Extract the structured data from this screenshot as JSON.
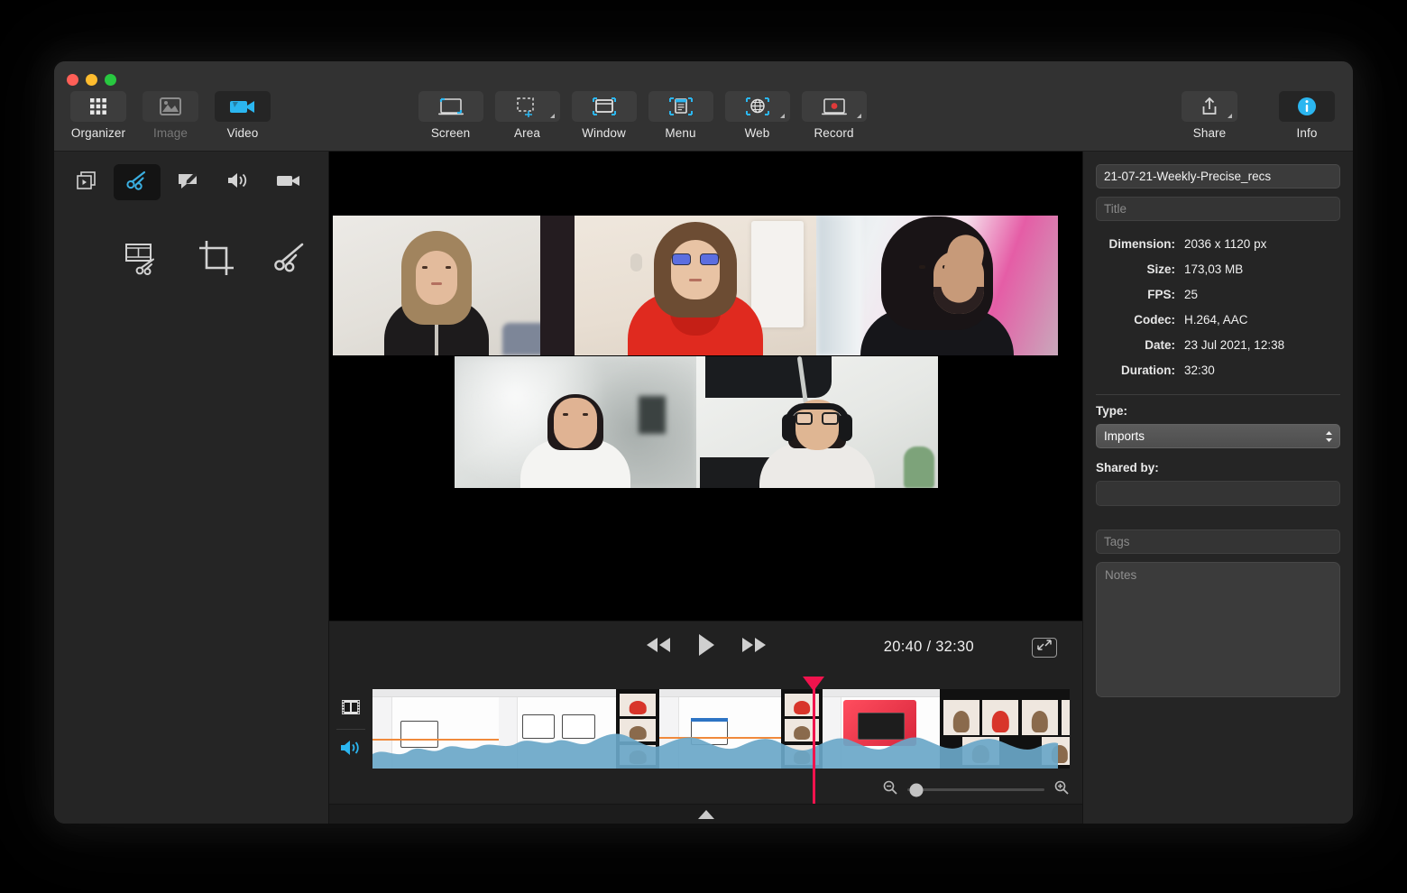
{
  "toolbar": {
    "left_items": [
      {
        "label": "Organizer",
        "icon": "grid-icon",
        "state": "normal"
      },
      {
        "label": "Image",
        "icon": "image-icon",
        "state": "disabled"
      },
      {
        "label": "Video",
        "icon": "video-camera-icon",
        "state": "selected"
      }
    ],
    "center_items": [
      {
        "label": "Screen",
        "icon": "screen-capture-icon"
      },
      {
        "label": "Area",
        "icon": "area-selection-icon"
      },
      {
        "label": "Window",
        "icon": "window-capture-icon"
      },
      {
        "label": "Menu",
        "icon": "menu-capture-icon"
      },
      {
        "label": "Web",
        "icon": "globe-web-capture-icon"
      },
      {
        "label": "Record",
        "icon": "record-icon"
      }
    ],
    "right_items": [
      {
        "label": "Share",
        "icon": "share-upload-icon"
      },
      {
        "label": "Info",
        "icon": "info-circle-icon"
      }
    ]
  },
  "left_panel": {
    "row1": [
      {
        "name": "clips-icon",
        "active": false
      },
      {
        "name": "scissors-icon",
        "active": true
      },
      {
        "name": "annotation-icon",
        "active": false
      },
      {
        "name": "audio-speaker-icon",
        "active": false
      },
      {
        "name": "camera-icon",
        "active": false
      }
    ],
    "row2": [
      {
        "name": "film-trim-icon"
      },
      {
        "name": "crop-icon"
      },
      {
        "name": "scissors-cut-icon"
      }
    ]
  },
  "player": {
    "rewind_label": "rewind-icon",
    "play_label": "play-icon",
    "forward_label": "fast-forward-icon",
    "time_current": "20:40",
    "time_separator": "/",
    "time_total": "32:30",
    "time_readout": "20:40 / 32:30",
    "fullscreen_icon": "fullscreen-icon"
  },
  "timeline": {
    "video_track_icon": "film-strip-icon",
    "audio_track_icon": "speaker-icon",
    "playhead_position_pct": 62,
    "zoom_out_icon": "zoom-out-icon",
    "zoom_in_icon": "zoom-in-icon",
    "zoom_level_pct": 7
  },
  "info_panel": {
    "filename": "21-07-21-Weekly-Precise_recs",
    "title_placeholder": "Title",
    "title_value": "",
    "metadata": [
      {
        "label": "Dimension:",
        "value": "2036 x 1120 px"
      },
      {
        "label": "Size:",
        "value": "173,03 MB"
      },
      {
        "label": "FPS:",
        "value": "25"
      },
      {
        "label": "Codec:",
        "value": "H.264, AAC"
      },
      {
        "label": "Date:",
        "value": "23 Jul 2021, 12:38"
      },
      {
        "label": "Duration:",
        "value": "32:30"
      }
    ],
    "type_label": "Type:",
    "type_value": "Imports",
    "shared_by_label": "Shared by:",
    "shared_by_value": "",
    "tags_placeholder": "Tags",
    "tags_value": "",
    "notes_placeholder": "Notes",
    "notes_value": ""
  },
  "colors": {
    "accent_blue": "#2bb6f0",
    "playhead_pink": "#f0134d",
    "waveform_blue": "#6aa7c8",
    "record_red": "#e03a3a"
  },
  "disclosure": {
    "icon": "triangle-up-icon"
  }
}
